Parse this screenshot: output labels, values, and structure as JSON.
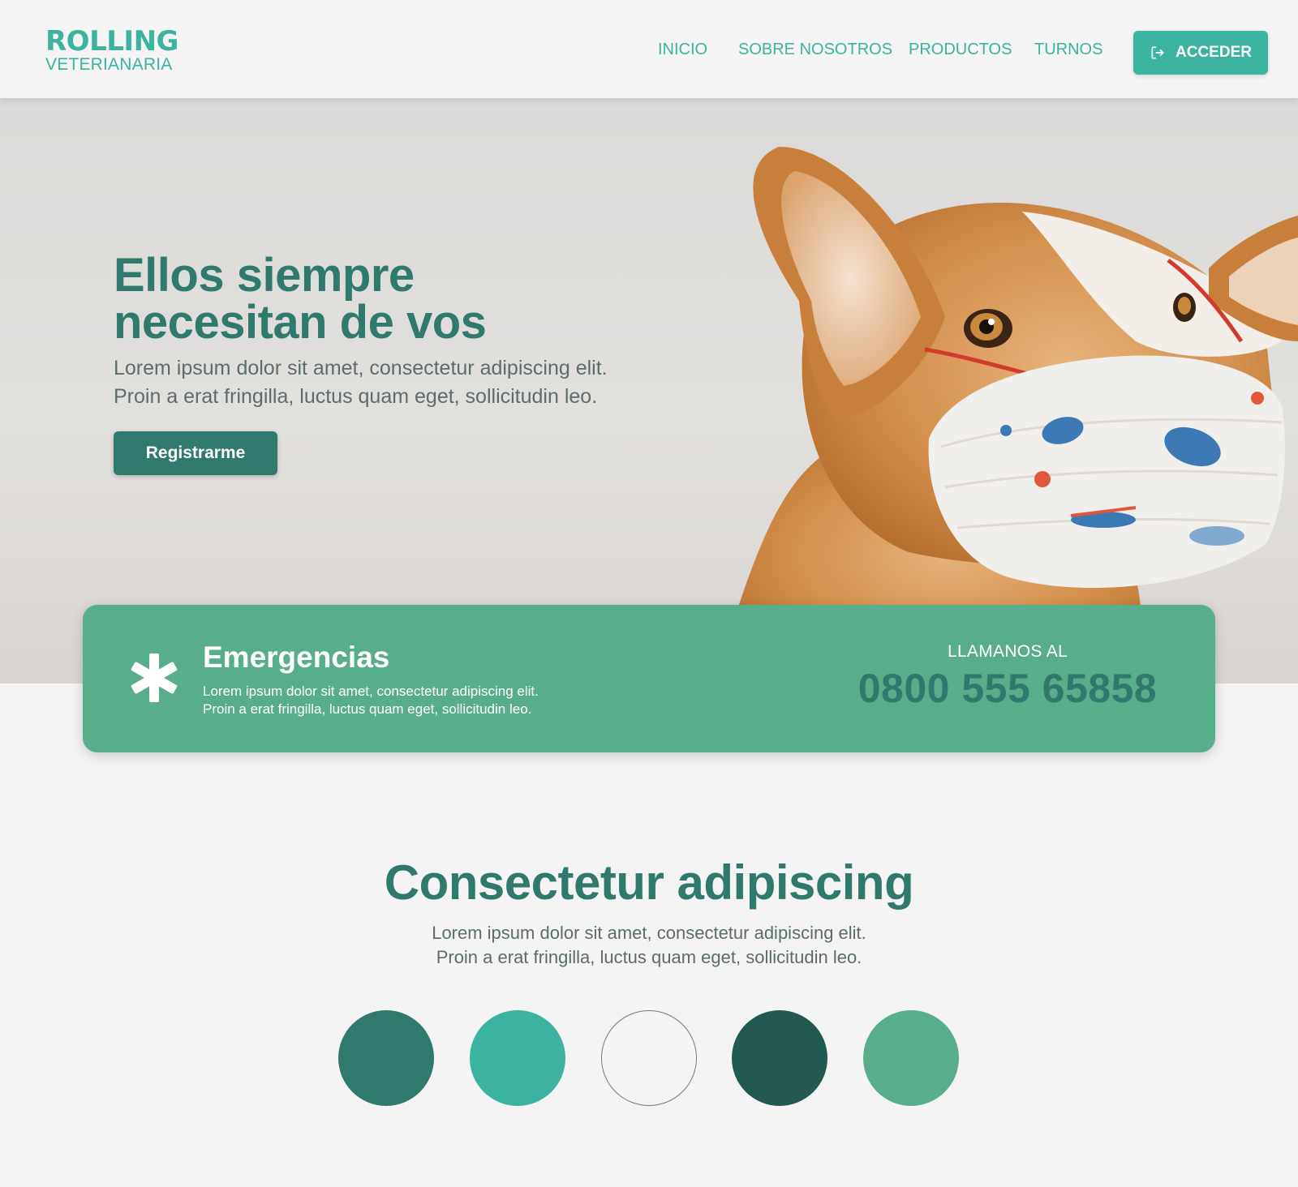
{
  "brand": {
    "name_top": "ROLLING",
    "name_bottom": "VETERIANARIA"
  },
  "nav": {
    "items": [
      {
        "label": "INICIO"
      },
      {
        "label": "SOBRE NOSOTROS"
      },
      {
        "label": "PRODUCTOS"
      },
      {
        "label": "TURNOS"
      }
    ],
    "login_label": "ACCEDER",
    "login_icon": "login-arrow-icon"
  },
  "hero": {
    "title_line1": "Ellos siempre",
    "title_line2": "necesitan de vos",
    "text_line1": "Lorem ipsum dolor sit amet, consectetur adipiscing elit.",
    "text_line2": "Proin a erat fringilla, luctus quam eget, sollicitudin leo.",
    "cta_label": "Registrarme"
  },
  "emergency": {
    "icon": "asterisk-icon",
    "title": "Emergencias",
    "text_line1": "Lorem ipsum dolor sit amet, consectetur adipiscing elit.",
    "text_line2": "Proin a erat fringilla, luctus quam eget, sollicitudin leo.",
    "call_label": "LLAMANOS AL",
    "phone": "0800 555 65858"
  },
  "section": {
    "title": "Consectetur adipiscing",
    "text_line1": "Lorem ipsum dolor sit amet, consectetur adipiscing elit.",
    "text_line2": "Proin a erat fringilla, luctus quam eget, sollicitudin leo."
  },
  "palette": [
    "#2f7a6d",
    "#3bb39f",
    "#f5f5f5",
    "#225a52",
    "#58ae8a"
  ],
  "colors": {
    "primary": "#2f7a6d",
    "accent": "#3bb39f",
    "emergency_bg": "#58ae8a"
  }
}
